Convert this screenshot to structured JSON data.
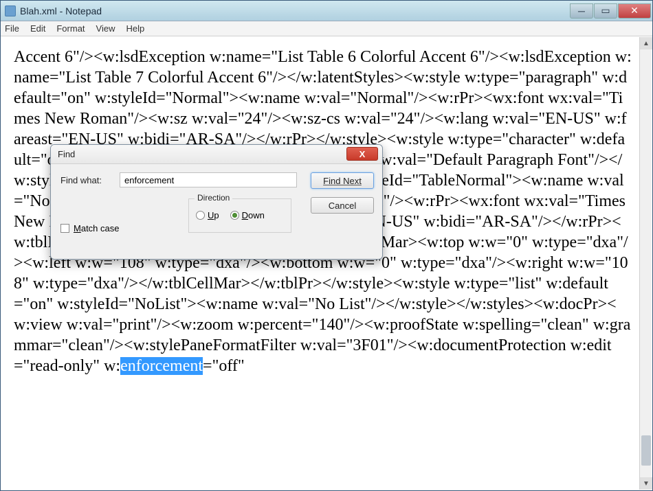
{
  "window": {
    "title": "Blah.xml - Notepad"
  },
  "menu": {
    "file": "File",
    "edit": "Edit",
    "format": "Format",
    "view": "View",
    "help": "Help"
  },
  "document": {
    "pre_highlight": "Accent 6\"/><w:lsdException w:name=\"List Table 6 Colorful Accent 6\"/><w:lsdException w:name=\"List Table 7 Colorful Accent 6\"/></w:latentStyles><w:style w:type=\"paragraph\" w:default=\"on\" w:styleId=\"Normal\"><w:name w:val=\"Normal\"/><w:rPr><wx:font wx:val=\"Times New Roman\"/><w:sz w:val=\"24\"/><w:sz-cs w:val=\"24\"/><w:lang w:val=\"EN-US\" w:fareast=\"EN-US\" w:bidi=\"AR-SA\"/></w:rPr></w:style><w:style w:type=\"character\" w:default=\"on\" w:styleId=\"DefaultParagraphFont\"><w:name w:val=\"Default Paragraph Font\"/></w:style><w:style w:type=\"table\" w:default=\"on\" w:styleId=\"TableNormal\"><w:name w:val=\"Normal Table\"/><wx:uiName wx:val=\"Table Normal\"/><w:rPr><wx:font wx:val=\"Times New Roman\"/><w:lang w:val=\"EN-US\" w:fareast=\"EN-US\" w:bidi=\"AR-SA\"/></w:rPr><w:tblPr><w:tblInd w:w=\"0\" w:type=\"dxa\"/><w:tblCellMar><w:top w:w=\"0\" w:type=\"dxa\"/><w:left w:w=\"108\" w:type=\"dxa\"/><w:bottom w:w=\"0\" w:type=\"dxa\"/><w:right w:w=\"108\" w:type=\"dxa\"/></w:tblCellMar></w:tblPr></w:style><w:style w:type=\"list\" w:default=\"on\" w:styleId=\"NoList\"><w:name w:val=\"No List\"/></w:style></w:styles><w:docPr><w:view w:val=\"print\"/><w:zoom w:percent=\"140\"/><w:proofState w:spelling=\"clean\" w:grammar=\"clean\"/><w:stylePaneFormatFilter w:val=\"3F01\"/><w:documentProtection w:edit=\"read-only\" w:",
    "highlight": "enforcement",
    "post_highlight": "=\"off\""
  },
  "find": {
    "title": "Find",
    "what_label": "Find what:",
    "what_value": "enforcement",
    "find_next": "Find Next",
    "cancel": "Cancel",
    "direction_label": "Direction",
    "up_u": "U",
    "up_rest": "p",
    "down_d": "D",
    "down_rest": "own",
    "match_m": "M",
    "match_rest": "atch case",
    "close_glyph": "X"
  },
  "win_controls": {
    "min": "─",
    "max": "▭",
    "close": "✕"
  },
  "scroll": {
    "up": "▲",
    "down": "▼"
  }
}
